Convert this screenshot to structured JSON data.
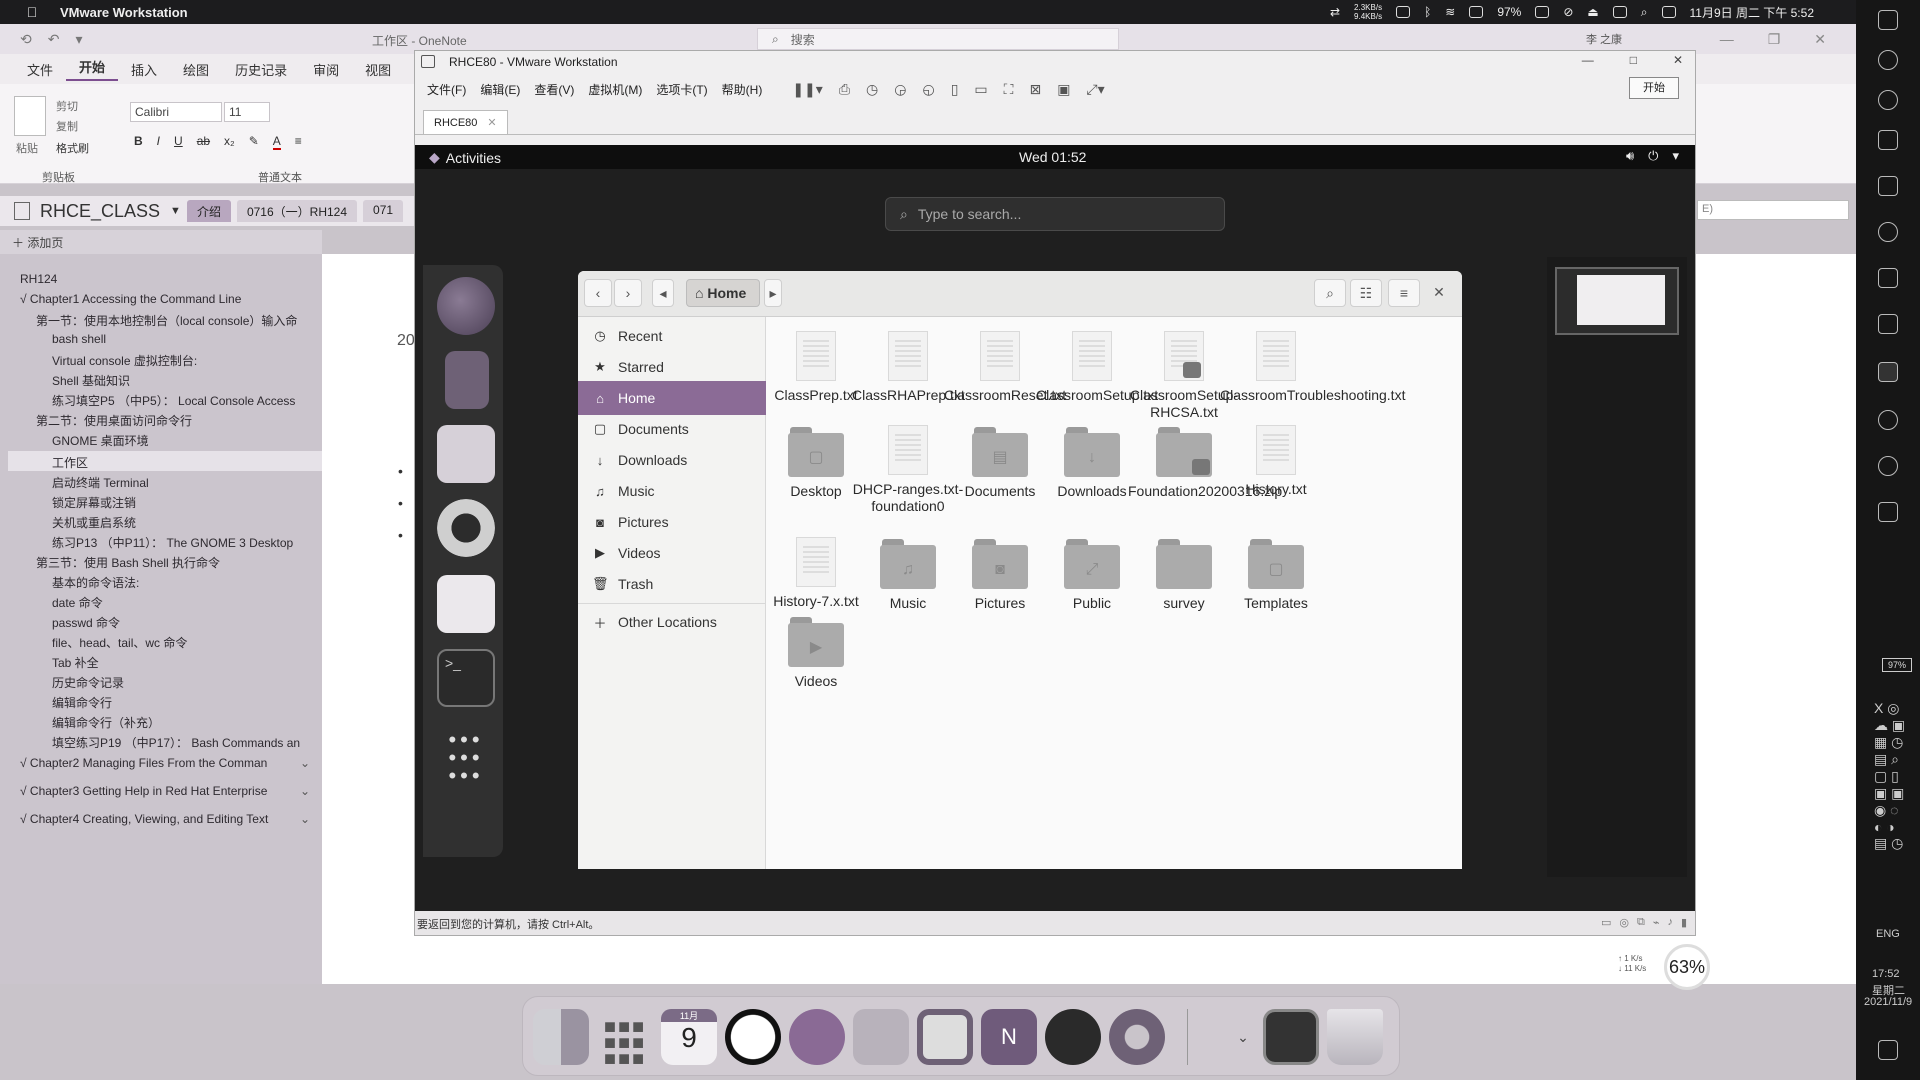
{
  "macbar": {
    "app": "VMware Workstation",
    "net_up": "2.3KB/s",
    "net_down": "9.4KB/s",
    "battery": "97%",
    "datetime": "11月9日 周二 下午 5:52"
  },
  "onenote": {
    "title": "工作区 - OneNote",
    "search_placeholder": "搜索",
    "user": "李 之康",
    "ribbon_tabs": [
      "文件",
      "开始",
      "插入",
      "绘图",
      "历史记录",
      "审阅",
      "视图"
    ],
    "font_name": "Calibri",
    "font_size": "11",
    "paste": "粘贴",
    "cut": "剪切",
    "copy": "复制",
    "format_painter": "格式刷",
    "clipboard": "剪贴板",
    "basic_text": "普通文本",
    "notebook": "RHCE_CLASS",
    "section_tabs": [
      "介绍",
      "0716（一）RH124",
      "071"
    ],
    "add_page": "添加页",
    "pages": [
      {
        "text": "RH124",
        "level": 0
      },
      {
        "text": "√ Chapter1 Accessing the Command Line",
        "level": 0
      },
      {
        "text": "第一节：使用本地控制台（local console）输入命",
        "level": 1
      },
      {
        "text": "bash shell",
        "level": 2
      },
      {
        "text": "Virtual console 虚拟控制台:",
        "level": 2
      },
      {
        "text": "Shell 基础知识",
        "level": 2
      },
      {
        "text": "练习填空P5 （中P5）： Local Console Access",
        "level": 2
      },
      {
        "text": "第二节：使用桌面访问命令行",
        "level": 1
      },
      {
        "text": "GNOME 桌面环境",
        "level": 2
      },
      {
        "text": "工作区",
        "level": 2
      },
      {
        "text": "启动终端 Terminal",
        "level": 2
      },
      {
        "text": "锁定屏幕或注销",
        "level": 2
      },
      {
        "text": "关机或重启系统",
        "level": 2
      },
      {
        "text": "练习P13 （中P11）： The GNOME 3 Desktop",
        "level": 2
      },
      {
        "text": "第三节：使用 Bash Shell 执行命令",
        "level": 1
      },
      {
        "text": "基本的命令语法:",
        "level": 2
      },
      {
        "text": "date 命令",
        "level": 2
      },
      {
        "text": "passwd 命令",
        "level": 2
      },
      {
        "text": "file、head、tail、wc 命令",
        "level": 2
      },
      {
        "text": "Tab 补全",
        "level": 2
      },
      {
        "text": "历史命令记录",
        "level": 2
      },
      {
        "text": "编辑命令行",
        "level": 2
      },
      {
        "text": "编辑命令行（补充）",
        "level": 2
      },
      {
        "text": "填空练习P19 （中P17）： Bash Commands an",
        "level": 2
      }
    ],
    "chapters": [
      "√ Chapter2 Managing Files From the Comman",
      "√ Chapter3 Getting Help in Red Hat Enterprise",
      "√ Chapter4 Creating, Viewing, and Editing Text"
    ],
    "note_fragment": "20",
    "right_search": "E)"
  },
  "vmware": {
    "title": "RHCE80 - VMware Workstation",
    "start_button": "开始",
    "menu": [
      "文件(F)",
      "编辑(E)",
      "查看(V)",
      "虚拟机(M)",
      "选项卡(T)",
      "帮助(H)"
    ],
    "tab": "RHCE80",
    "status": "要返回到您的计算机，请按 Ctrl+Alt。"
  },
  "gnome": {
    "activities": "Activities",
    "clock": "Wed 01:52",
    "search_placeholder": "Type to search..."
  },
  "nautilus": {
    "location": "Home",
    "sidebar": [
      {
        "icon": "clock-icon",
        "label": "Recent"
      },
      {
        "icon": "star-icon",
        "label": "Starred"
      },
      {
        "icon": "home-icon",
        "label": "Home"
      },
      {
        "icon": "document-icon",
        "label": "Documents"
      },
      {
        "icon": "download-icon",
        "label": "Downloads"
      },
      {
        "icon": "music-icon",
        "label": "Music"
      },
      {
        "icon": "camera-icon",
        "label": "Pictures"
      },
      {
        "icon": "video-icon",
        "label": "Videos"
      },
      {
        "icon": "trash-icon",
        "label": "Trash"
      }
    ],
    "other_locations": "Other Locations",
    "files": [
      {
        "name": "ClassPrep.txt",
        "type": "doc"
      },
      {
        "name": "ClassRHAPrep.txt",
        "type": "doc"
      },
      {
        "name": "ClassroomReset.txt",
        "type": "doc"
      },
      {
        "name": "ClassroomSetup.txt",
        "type": "doc"
      },
      {
        "name": "ClassroomSetup-RHCSA.txt",
        "type": "doc-locked"
      },
      {
        "name": "ClassroomTroubleshooting.txt",
        "type": "doc"
      },
      {
        "name": "Desktop",
        "type": "folder"
      },
      {
        "name": "DHCP-ranges.txt-foundation0",
        "type": "doc"
      },
      {
        "name": "Documents",
        "type": "folder"
      },
      {
        "name": "Downloads",
        "type": "folder"
      },
      {
        "name": "Foundation20200316.zip",
        "type": "zip-locked"
      },
      {
        "name": "History.txt",
        "type": "doc"
      },
      {
        "name": "History-7.x.txt",
        "type": "doc"
      },
      {
        "name": "Music",
        "type": "folder"
      },
      {
        "name": "Pictures",
        "type": "folder"
      },
      {
        "name": "Public",
        "type": "folder"
      },
      {
        "name": "survey",
        "type": "folder"
      },
      {
        "name": "Templates",
        "type": "folder"
      },
      {
        "name": "Videos",
        "type": "folder"
      }
    ]
  },
  "dock": {
    "calendar_month": "11月",
    "calendar_day": "9"
  },
  "taskbar": {
    "battery": "97%",
    "lang": "ENG",
    "time": "17:52",
    "weekday": "星期二",
    "date": "2021/11/9"
  },
  "overlay": {
    "gauge": "63%",
    "net_up": "↑ 1 K/s",
    "net_down": "↓ 11 K/s"
  }
}
